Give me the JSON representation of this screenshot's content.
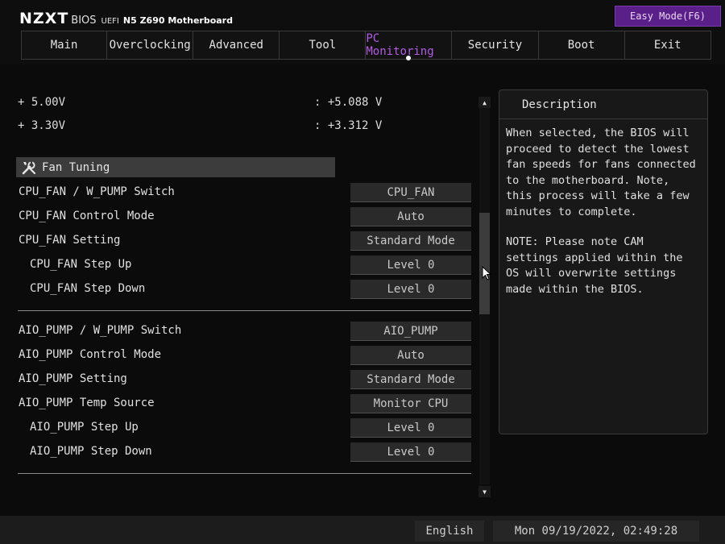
{
  "header": {
    "brand": "NZXT",
    "bios": "BIOS",
    "uefi": "UEFI",
    "model": "N5 Z690 Motherboard",
    "easy_mode": "Easy Mode(F6)"
  },
  "tabs": [
    {
      "label": "Main"
    },
    {
      "label": "Overclocking"
    },
    {
      "label": "Advanced"
    },
    {
      "label": "Tool"
    },
    {
      "label": "PC Monitoring",
      "active": true
    },
    {
      "label": "Security"
    },
    {
      "label": "Boot"
    },
    {
      "label": "Exit"
    }
  ],
  "voltages": [
    {
      "label": "+ 5.00V",
      "value": ": +5.088 V"
    },
    {
      "label": "+ 3.30V",
      "value": ": +3.312 V"
    }
  ],
  "section": {
    "title": "Fan Tuning",
    "icon": "tools-icon"
  },
  "fan_rows": [
    {
      "label": "CPU_FAN / W_PUMP Switch",
      "value": "CPU_FAN"
    },
    {
      "label": "CPU_FAN Control Mode",
      "value": "Auto"
    },
    {
      "label": "CPU_FAN Setting",
      "value": "Standard Mode"
    },
    {
      "label": "CPU_FAN Step Up",
      "value": "Level 0",
      "sub": true
    },
    {
      "label": "CPU_FAN Step Down",
      "value": "Level 0",
      "sub": true
    }
  ],
  "pump_rows": [
    {
      "label": "AIO_PUMP / W_PUMP Switch",
      "value": "AIO_PUMP"
    },
    {
      "label": "AIO_PUMP Control Mode",
      "value": "Auto"
    },
    {
      "label": "AIO_PUMP Setting",
      "value": "Standard Mode"
    },
    {
      "label": "AIO_PUMP Temp Source",
      "value": "Monitor CPU"
    },
    {
      "label": "AIO_PUMP Step Up",
      "value": "Level 0",
      "sub": true
    },
    {
      "label": "AIO_PUMP Step Down",
      "value": "Level 0",
      "sub": true
    }
  ],
  "description": {
    "title": "Description",
    "para1": "When selected, the BIOS will proceed to detect the lowest fan speeds for fans connected to the motherboard. Note, this process will take a few minutes to complete.",
    "para2": "NOTE: Please note CAM settings applied within the OS will overwrite settings made within the BIOS."
  },
  "footer": {
    "language": "English",
    "datetime": "Mon 09/19/2022, 02:49:28"
  },
  "colors": {
    "accent": "#b35ce6",
    "easy_mode_bg": "#5b1f8a",
    "section_bg": "#3c3c3c"
  }
}
